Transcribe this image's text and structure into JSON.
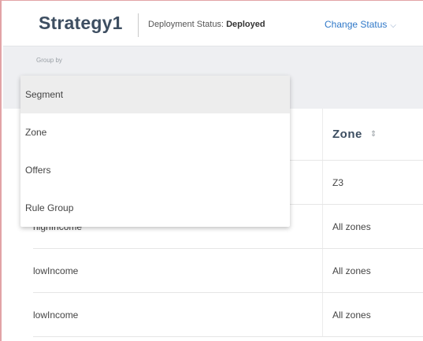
{
  "header": {
    "title": "Strategy1",
    "deployment_label": "Deployment Status:",
    "deployment_value": "Deployed",
    "change_status_label": "Change Status",
    "change_status_icon": "chevron-down-icon"
  },
  "toolbar": {
    "group_by_label": "Group by"
  },
  "group_by_menu": {
    "selected": "Segment",
    "items": [
      "Segment",
      "Zone",
      "Offers",
      "Rule Group"
    ]
  },
  "table": {
    "zone_header": "Zone",
    "sort_icon": "sort-icon",
    "rows": [
      {
        "name": "",
        "zone": "Z3"
      },
      {
        "name": "highIncome",
        "zone": "All zones"
      },
      {
        "name": "lowIncome",
        "zone": "All zones"
      },
      {
        "name": "lowIncome",
        "zone": "All zones"
      }
    ]
  },
  "colors": {
    "title": "#3d4e61",
    "link": "#2f78c8",
    "band": "#eeeff2",
    "frame_border": "#e2a3a6"
  }
}
